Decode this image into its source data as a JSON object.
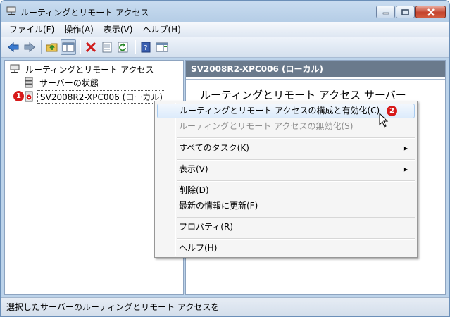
{
  "window": {
    "title": "ルーティングとリモート アクセス"
  },
  "menubar": [
    {
      "label": "ファイル(F)"
    },
    {
      "label": "操作(A)"
    },
    {
      "label": "表示(V)"
    },
    {
      "label": "ヘルプ(H)"
    }
  ],
  "toolbar": {
    "icons": [
      "back-arrow-icon",
      "forward-arrow-icon",
      "up-folder-icon",
      "show-hide-tree-icon",
      "delete-icon",
      "properties-icon",
      "refresh-icon",
      "help-icon",
      "action-pane-icon"
    ]
  },
  "tree": {
    "root": "ルーティングとリモート アクセス",
    "server_status": "サーバーの状態",
    "server": "SV2008R2-XPC006 (ローカル)"
  },
  "right": {
    "header": "SV2008R2-XPC006 (ローカル)",
    "heading": "ルーティングとリモート アクセス サーバー"
  },
  "context_menu": [
    {
      "label": "ルーティングとリモート アクセスの構成と有効化(C)",
      "state": "hover"
    },
    {
      "label": "ルーティングとリモート アクセスの無効化(S)",
      "state": "disabled"
    },
    {
      "label": "すべてのタスク(K)",
      "submenu": true
    },
    {
      "label": "表示(V)",
      "submenu": true
    },
    {
      "label": "削除(D)"
    },
    {
      "label": "最新の情報に更新(F)"
    },
    {
      "label": "プロパティ(R)"
    },
    {
      "label": "ヘルプ(H)"
    }
  ],
  "badges": {
    "first": "1",
    "second": "2"
  },
  "status": {
    "text": "選択したサーバーのルーティングとリモート アクセスを構成して有効にします。"
  },
  "colors": {
    "badge": "#d71a1a",
    "header_bg": "#6a7a8c",
    "menu_hover_border": "#a8cbf0"
  }
}
